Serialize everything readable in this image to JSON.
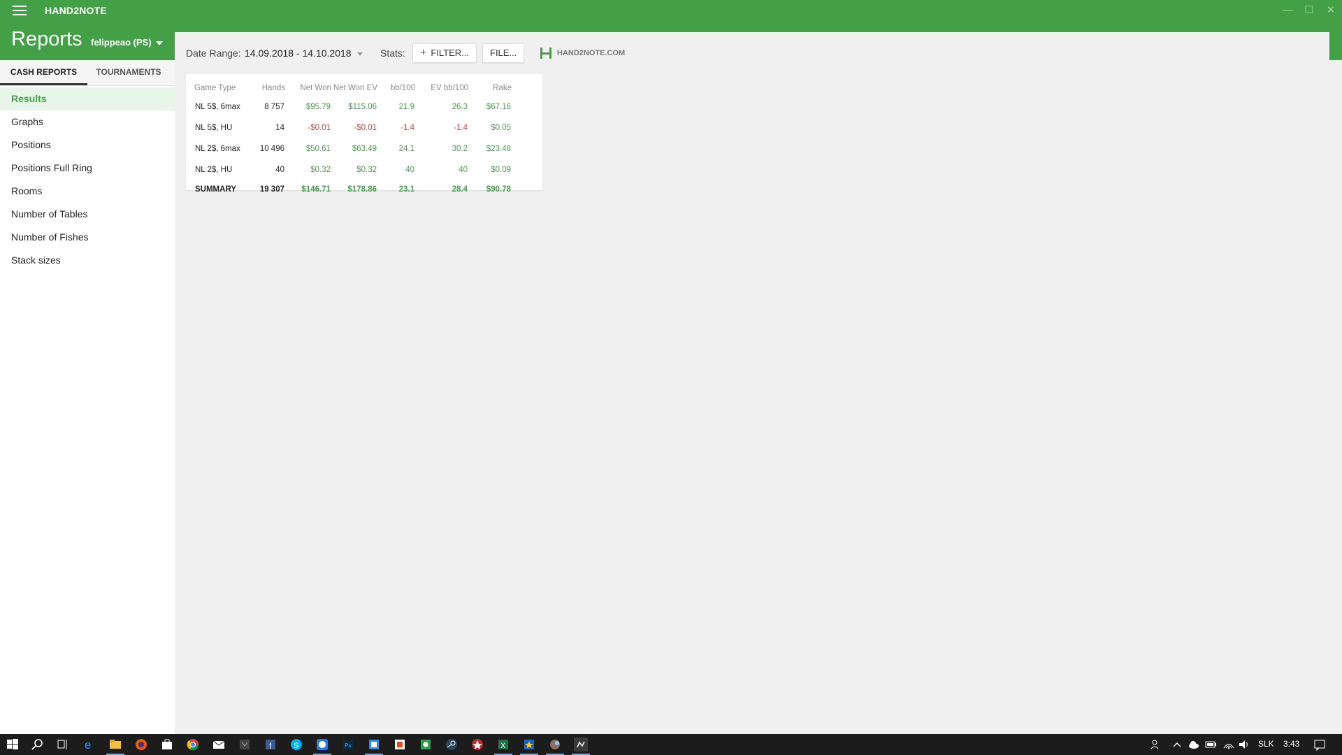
{
  "app": {
    "title": "HAND2NOTE"
  },
  "header": {
    "title": "Reports",
    "player": "felippeao (PS)"
  },
  "sidebar": {
    "tabs": [
      {
        "label": "CASH REPORTS",
        "active": true
      },
      {
        "label": "TOURNAMENTS",
        "active": false
      }
    ],
    "items": [
      {
        "label": "Results",
        "active": true
      },
      {
        "label": "Graphs"
      },
      {
        "label": "Positions"
      },
      {
        "label": "Positions Full Ring"
      },
      {
        "label": "Rooms"
      },
      {
        "label": "Number of Tables"
      },
      {
        "label": "Number of Fishes"
      },
      {
        "label": "Stack sizes"
      }
    ]
  },
  "toolbar": {
    "date_range_label": "Date Range:",
    "date_range_value": "14.09.2018 - 14.10.2018",
    "stats_label": "Stats:",
    "filter_button": "FILTER...",
    "file_button": "FILE...",
    "brand_text": "HAND2NOTE.COM"
  },
  "table": {
    "columns": [
      "Game Type",
      "Hands",
      "Net Won",
      "Net Won  EV",
      "bb/100",
      "EV bb/100",
      "Rake"
    ],
    "rows": [
      [
        "NL 5$, 6max",
        "8 757",
        "$95.79",
        "$115.06",
        "21.9",
        "26.3",
        "$67.16"
      ],
      [
        "NL 5$, HU",
        "14",
        "-$0.01",
        "-$0.01",
        "-1.4",
        "-1.4",
        "$0.05"
      ],
      [
        "NL 2$, 6max",
        "10 496",
        "$50.61",
        "$63.49",
        "24.1",
        "30.2",
        "$23.48"
      ],
      [
        "NL 2$, HU",
        "40",
        "$0.32",
        "$0.32",
        "40",
        "40",
        "$0.09"
      ]
    ],
    "summary": [
      "SUMMARY",
      "19 307",
      "$146.71",
      "$178.86",
      "23.1",
      "28.4",
      "$90.78"
    ]
  },
  "taskbar": {
    "language": "SLK",
    "time": "3:43"
  },
  "colors": {
    "accent": "#43a047",
    "positive": "#43a047",
    "negative": "#e53935"
  }
}
